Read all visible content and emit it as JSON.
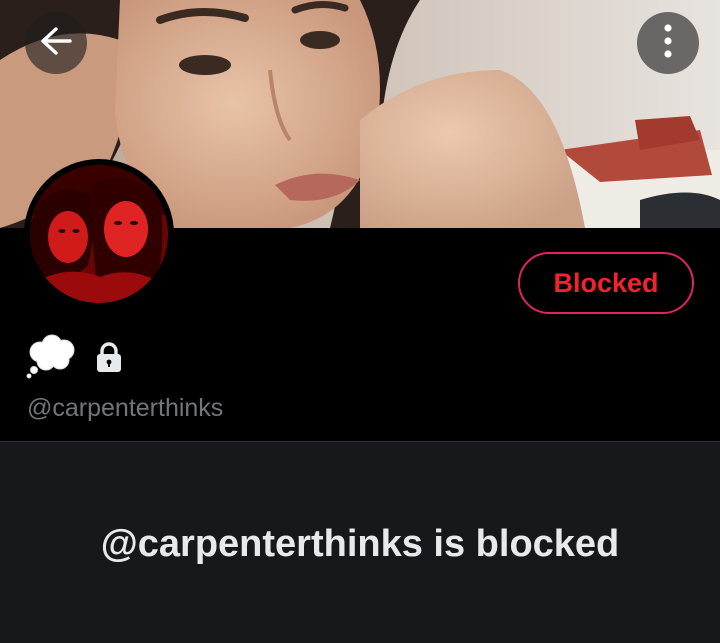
{
  "header": {
    "back_icon": "arrow-left-icon",
    "more_icon": "more-vertical-icon"
  },
  "profile": {
    "display_name_emoji": "💭",
    "protected_icon": "lock-icon",
    "handle": "@carpenterthinks",
    "blocked_button_label": "Blocked"
  },
  "notice": {
    "title": "@carpenterthinks is blocked"
  },
  "colors": {
    "background": "#000000",
    "notice_background": "#16181c",
    "blocked_accent": "#f4212e",
    "secondary_text": "#71767b",
    "primary_text": "#e7e9ea"
  }
}
